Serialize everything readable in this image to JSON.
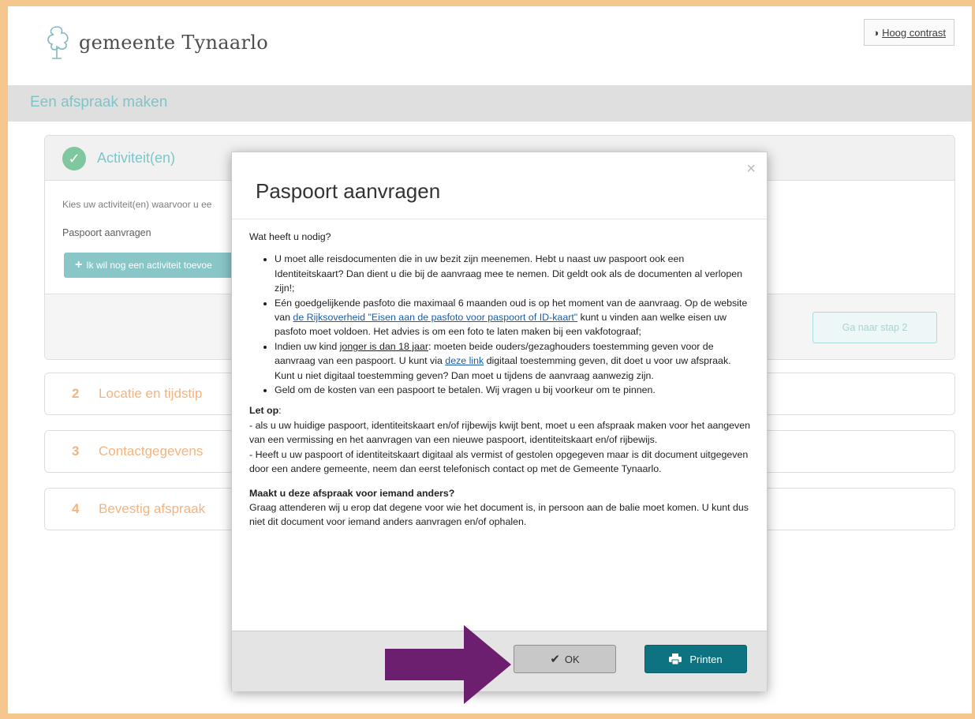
{
  "header": {
    "logo_text": "gemeente Tynaarlo",
    "contrast_button": "Hoog contrast"
  },
  "page_title": "Een afspraak maken",
  "step1": {
    "title": "Activiteit(en)",
    "instruction": "Kies uw activiteit(en) waarvoor u ee",
    "selected_activity": "Paspoort aanvragen",
    "add_button": "Ik wil nog een activiteit toevoe",
    "next_button": "Ga naar stap 2"
  },
  "steps": [
    {
      "number": "2",
      "label": "Locatie en tijdstip"
    },
    {
      "number": "3",
      "label": "Contactgegevens"
    },
    {
      "number": "4",
      "label": "Bevestig afspraak"
    }
  ],
  "modal": {
    "close": "×",
    "title": "Paspoort aanvragen",
    "intro": "Wat heeft u nodig?",
    "bullet1": "U moet alle reisdocumenten die in uw bezit zijn meenemen. Hebt u naast uw paspoort ook een Identiteitskaart? Dan dient u die bij de aanvraag mee te nemen. Dit geldt ook als de documenten al verlopen zijn!;",
    "bullet2_pre": "Eén goedgelijkende pasfoto die maximaal 6 maanden oud is op het moment van de aanvraag. Op de website van ",
    "bullet2_link": "de Rijksoverheid \"Eisen aan de pasfoto voor paspoort of ID-kaart\"",
    "bullet2_post": " kunt u vinden aan welke eisen uw pasfoto moet voldoen. Het advies is om een foto te laten maken bij een vakfotograaf;",
    "bullet3_pre": "Indien uw kind ",
    "bullet3_underline": "jonger is dan 18 jaar",
    "bullet3_mid": ": moeten beide ouders/gezaghouders toestemming geven voor de aanvraag van een paspoort. U kunt via ",
    "bullet3_link": "deze link",
    "bullet3_post": " digitaal toestemming geven, dit doet u voor uw afspraak. Kunt u niet digitaal toestemming geven? Dan moet u tijdens de aanvraag aanwezig zijn.",
    "bullet4": "Geld om de kosten van een paspoort te betalen. Wij vragen u bij voorkeur om  te pinnen.",
    "let_op": "Let op",
    "let_op_colon": ":",
    "note1": "- als u uw huidige paspoort, identiteitskaart en/of rijbewijs kwijt bent, moet u een afspraak maken voor het aangeven van een vermissing en het aanvragen van een nieuwe paspoort, identiteitskaart en/of rijbewijs.",
    "note2": "- Heeft u uw paspoort of identiteitskaart digitaal als vermist of gestolen opgegeven maar is dit document uitgegeven door een andere gemeente, neem dan eerst telefonisch contact op met de Gemeente Tynaarlo.",
    "question": "Maakt u deze afspraak voor iemand anders?",
    "answer": "Graag attenderen wij u erop dat degene voor wie het document is, in persoon aan de balie moet komen. U kunt dus niet dit document voor iemand anders aanvragen en/of ophalen.",
    "ok_button": "OK",
    "print_button": "Printen"
  },
  "colors": {
    "frame": "#f6c68f",
    "accent_teal": "#78c3c7",
    "step_orange": "#f2b07a",
    "print_button": "#0e7380",
    "arrow": "#6b1f6e"
  },
  "icons": [
    "logo-tree-icon",
    "contrast-icon",
    "check-icon",
    "plus-icon",
    "close-icon",
    "checkmark-icon",
    "printer-icon",
    "arrow-icon"
  ]
}
